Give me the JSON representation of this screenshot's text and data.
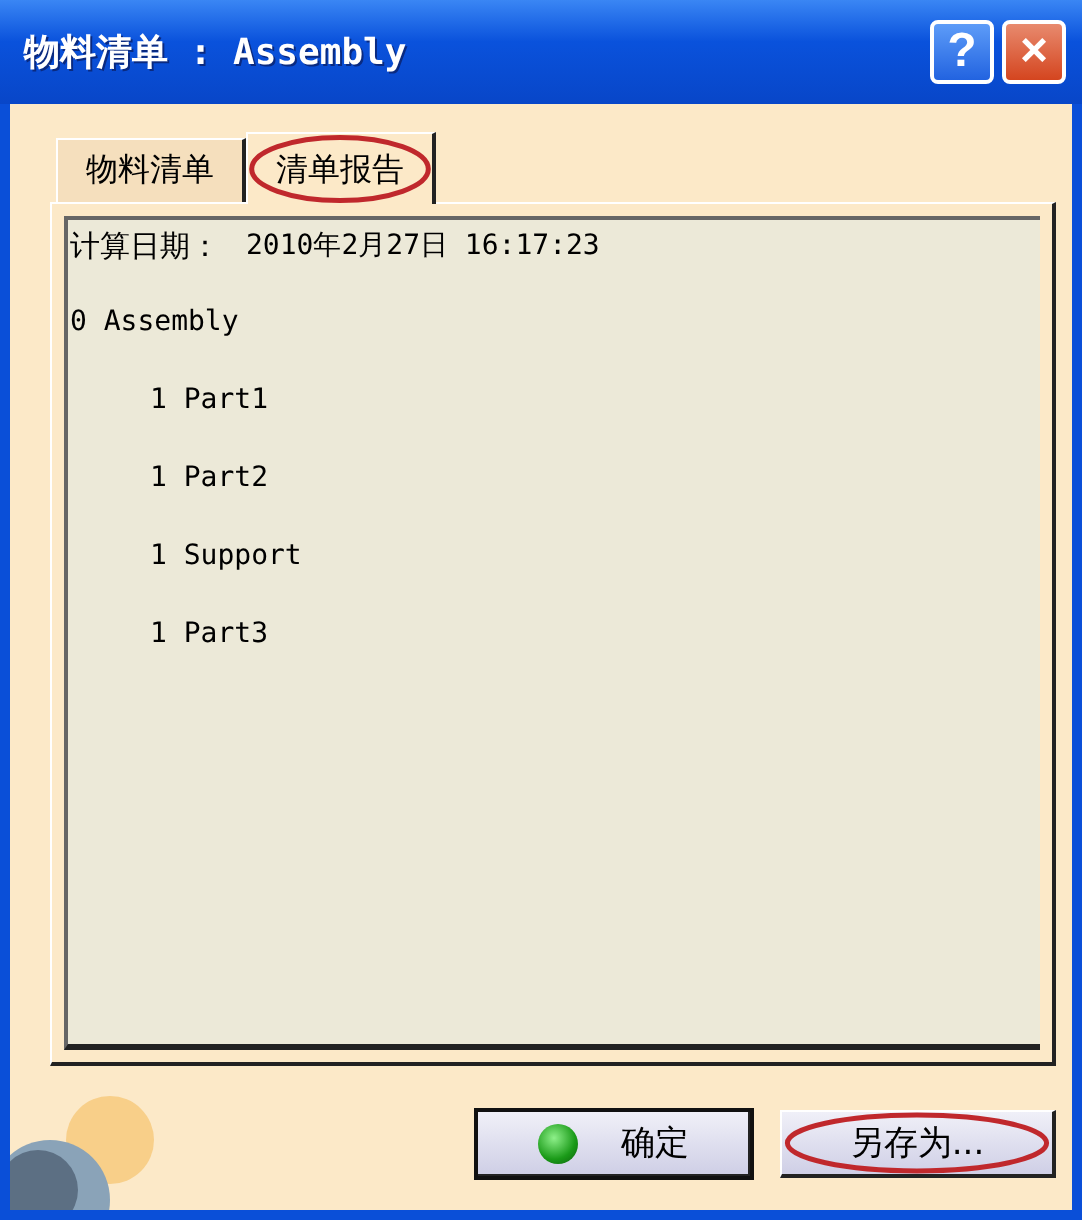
{
  "window": {
    "title": "物料清单 : Assembly",
    "title_buttons": [
      {
        "kind": "help",
        "label": "?"
      },
      {
        "kind": "close",
        "label": "×"
      }
    ]
  },
  "tabs": [
    {
      "label": "物料清单",
      "selected": false,
      "highlighted": false
    },
    {
      "label": "清单报告",
      "selected": true,
      "highlighted": true
    }
  ],
  "report": {
    "date_label": "计算日期：",
    "date_value": "2010年2月27日 16:17:23",
    "tree": [
      {
        "quantity": "0",
        "name": "Assembly",
        "children": [
          {
            "quantity": "1",
            "name": "Part1"
          },
          {
            "quantity": "1",
            "name": "Part2"
          },
          {
            "quantity": "1",
            "name": "Support"
          },
          {
            "quantity": "1",
            "name": "Part3"
          }
        ]
      }
    ]
  },
  "buttons": [
    {
      "kind": "ok",
      "label": "确定",
      "highlighted": false
    },
    {
      "kind": "save_as",
      "label": "另存为...",
      "highlighted": true
    }
  ]
}
